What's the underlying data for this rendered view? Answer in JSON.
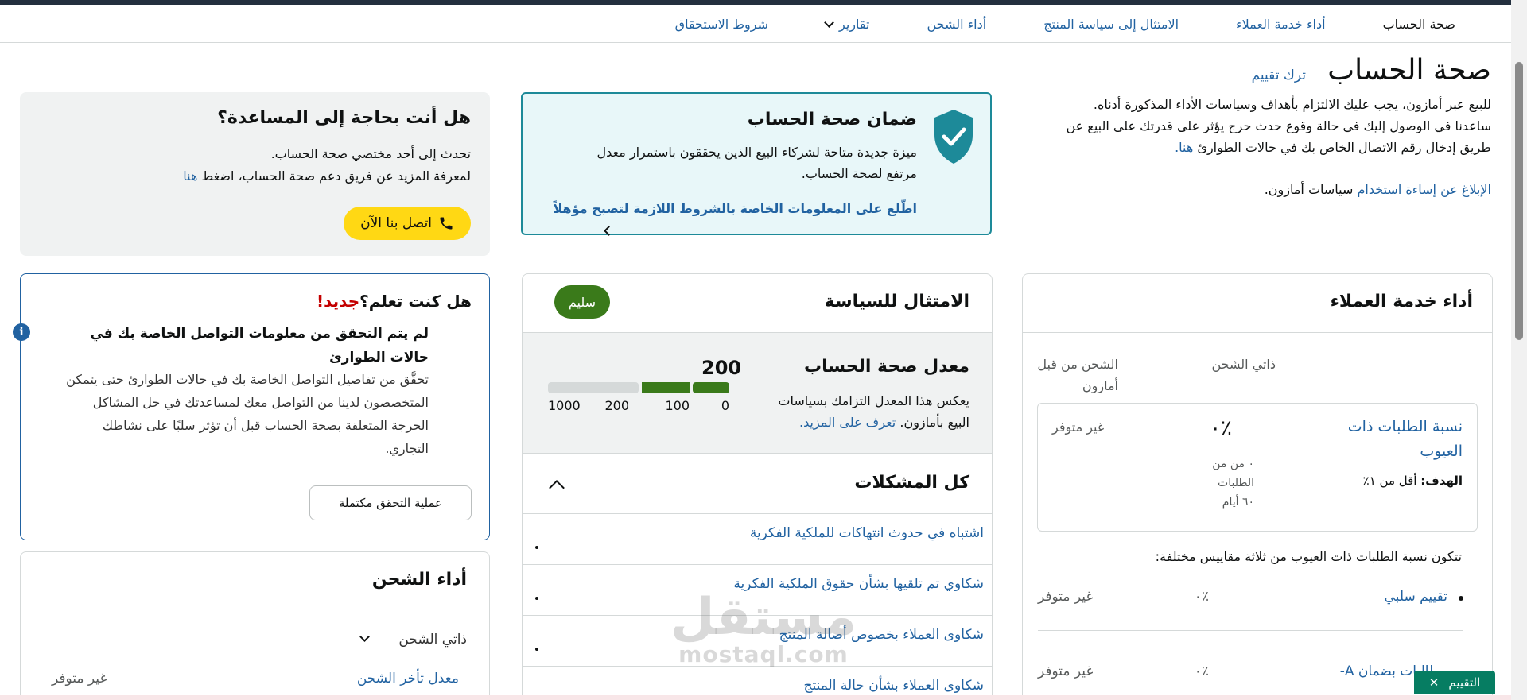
{
  "nav": {
    "items": [
      "صحة الحساب",
      "أداء خدمة العملاء",
      "الامتثال إلى سياسة المنتج",
      "أداء الشحن",
      "تقارير",
      "شروط الاستحقاق"
    ]
  },
  "header": {
    "title": "صحة الحساب",
    "feedback_link": "ترك تقييم",
    "intro_1": "للبيع عبر أمازون، يجب عليك الالتزام بأهداف وسياسات الأداء المذكورة أدناه.",
    "intro_2": "ساعدنا في الوصول إليك في حالة وقوع حدث حرج يؤثر على قدرتك على البيع عن",
    "intro_3": "طريق إدخال رقم الاتصال الخاص بك في حالات الطوارئ",
    "intro_3_link": "هنا.",
    "report_link": "الإبلاغ عن إساءة استخدام",
    "report_rest": "سياسات أمازون."
  },
  "guarantee": {
    "title": "ضمان صحة الحساب",
    "desc_1": "ميزة جديدة متاحة لشركاء البيع الذين يحققون باستمرار معدل",
    "desc_2": "مرتفع لصحة الحساب.",
    "cta": "اطّلع على المعلومات الخاصة بالشروط اللازمة لتصبح مؤهلاً",
    "accent": "#1d8a99"
  },
  "help": {
    "title": "هل أنت بحاجة إلى المساعدة؟",
    "line_1": "تحدث إلى أحد مختصي صحة الحساب.",
    "line_2": "لمعرفة المزيد عن فريق دعم صحة الحساب، اضغط",
    "line_2_link": "هنا",
    "contact_button": "اتصل بنا الآن",
    "button_color": "#ffd814"
  },
  "customer_service": {
    "title": "أداء خدمة العملاء",
    "col_seller": "ذاتي الشحن",
    "col_amazon_1": "الشحن من قبل",
    "col_amazon_2": "أمازون",
    "metric_name": "نسبة الطلبات ذات العيوب",
    "metric_goal_label": "الهدف:",
    "metric_goal": "أقل من ١٪",
    "metric_value": "٪٠",
    "metric_sub_1": "٠ من من",
    "metric_sub_2": "الطلبات",
    "metric_sub_3": "٦٠ أيام",
    "metric_na": "غير متوفر",
    "compose_text": "تتكون نسبة الطلبات ذات العيوب من ثلاثة مقاييس مختلفة:",
    "rows": [
      {
        "label": "تقييم سلبي",
        "value": "٪٠",
        "na": "غير متوفر"
      },
      {
        "label": "مطالبات بضمان A-",
        "value": "٪٠",
        "na": "غير متوفر"
      }
    ]
  },
  "policy": {
    "title": "الامتثال للسياسة",
    "badge": "سليم",
    "badge_color": "#3a7a1a",
    "ahr_title": "معدل صحة الحساب",
    "ahr_desc_1": "يعكس هذا المعدل التزامك بسياسات",
    "ahr_desc_2": "البيع بأمازون.",
    "ahr_link": "تعرف على المزيد.",
    "score": "200",
    "score_value": 200,
    "scale": [
      "0",
      "100",
      "200",
      "1000"
    ],
    "issues_title": "كل المشكلات",
    "issues": [
      "اشتباه في حدوث انتهاكات للملكية الفكرية",
      "شكاوي تم تلقيها بشأن حقوق الملكية الفكرية",
      "شكاوى العملاء بخصوص أصالة المنتج",
      "شكاوى العملاء بشأن حالة المنتج"
    ]
  },
  "didyou": {
    "title": "هل كنت تعلم؟",
    "new_tag": "جديد!",
    "subtitle": "لم يتم التحقق من معلومات التواصل الخاصة بك في حالات الطوارئ",
    "body": "تحقَّق من تفاصيل التواصل الخاصة بك في حالات الطوارئ حتى يتمكن المتخصصون لدينا من التواصل معك لمساعدتك في حل المشاكل الحرجة المتعلقة بصحة الحساب قبل أن تؤثر سلبًا على نشاطك التجاري.",
    "button": "عملية التحقق مكتملة"
  },
  "shipping": {
    "title": "أداء الشحن",
    "selector": "ذاتي الشحن",
    "metric": "معدل تأخر الشحن",
    "value": "غير متوفر"
  },
  "watermark": {
    "line_1": "مستقل",
    "line_2": "mostaql.com"
  },
  "rating_tab": {
    "label": "التقييم",
    "close": "✕"
  }
}
